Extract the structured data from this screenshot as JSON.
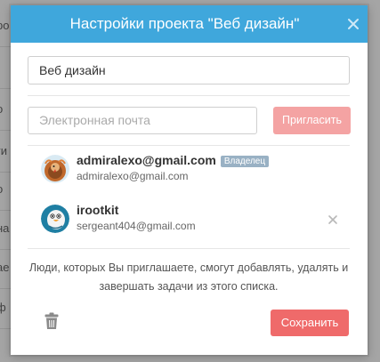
{
  "background": {
    "row_fragments": [
      "ро",
      "",
      "о",
      "ги",
      "о",
      "на",
      "ае",
      "ф"
    ]
  },
  "modal": {
    "title": "Настройки проекта \"Веб дизайн\"",
    "close_icon": "close-icon",
    "project_name_value": "Веб дизайн",
    "email_placeholder": "Электронная почта",
    "invite_label": "Пригласить",
    "members": [
      {
        "name": "admiralexo@gmail.com",
        "email": "admiralexo@gmail.com",
        "badge": "Владелец",
        "avatar_icon": "turkey-avatar-icon"
      },
      {
        "name": "irootkit",
        "email": "sergeant404@gmail.com",
        "avatar_icon": "bird-avatar-icon",
        "remove_icon": "remove-member-icon"
      }
    ],
    "info_text": "Люди, которых Вы приглашаете, смогут добавлять, удалять и завершать задачи из этого списка.",
    "delete_icon": "trash-icon",
    "save_label": "Сохранить"
  },
  "colors": {
    "header": "#3fa7dc",
    "invite_button_disabled": "#f4a3a3",
    "save_button": "#ef6a6a",
    "owner_badge": "#99b1c4"
  }
}
